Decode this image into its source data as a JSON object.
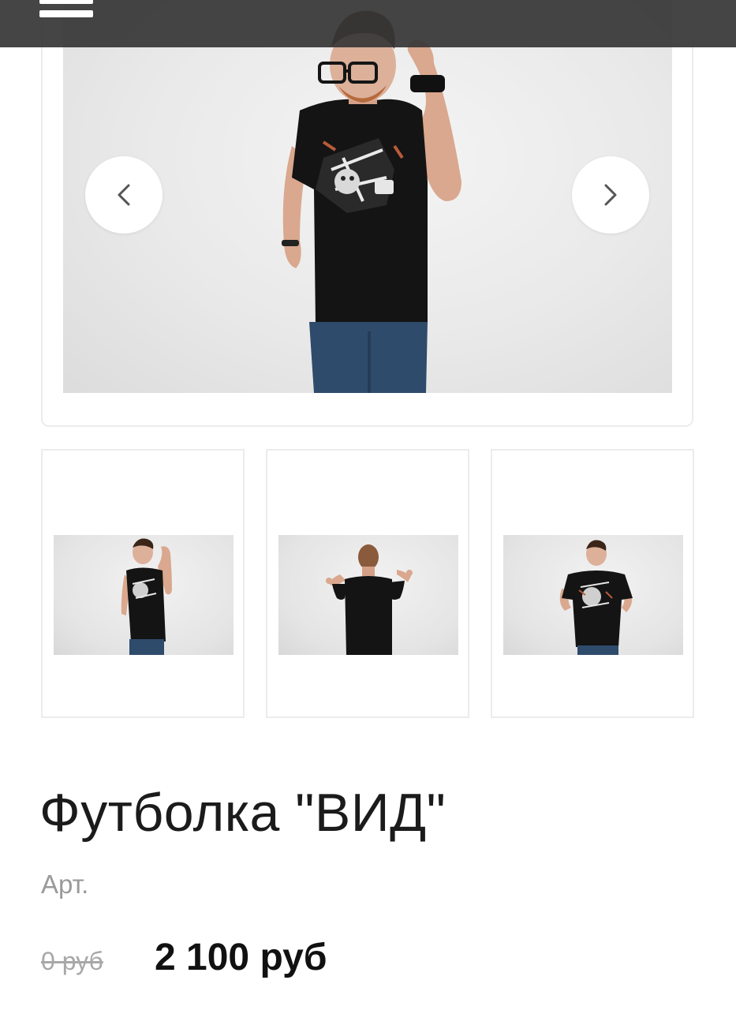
{
  "header": {
    "menu_icon": "hamburger-menu-icon"
  },
  "gallery": {
    "prev_icon": "chevron-left-icon",
    "next_icon": "chevron-right-icon",
    "main_image": "man-in-black-tshirt-front-fist-raised",
    "thumbnails": [
      {
        "image": "man-in-black-tshirt-front-fist-raised"
      },
      {
        "image": "man-in-black-tshirt-back-view"
      },
      {
        "image": "man-in-black-tshirt-front-hands-on-hips"
      }
    ]
  },
  "product": {
    "title": "Футболка \"ВИД\"",
    "sku_label": "Арт.",
    "old_price": "0 руб",
    "price": "2 100 руб"
  },
  "colors": {
    "topbar": "#373737",
    "shirt": "#141414",
    "jeans": "#2f4b6b",
    "border": "#ececec"
  }
}
